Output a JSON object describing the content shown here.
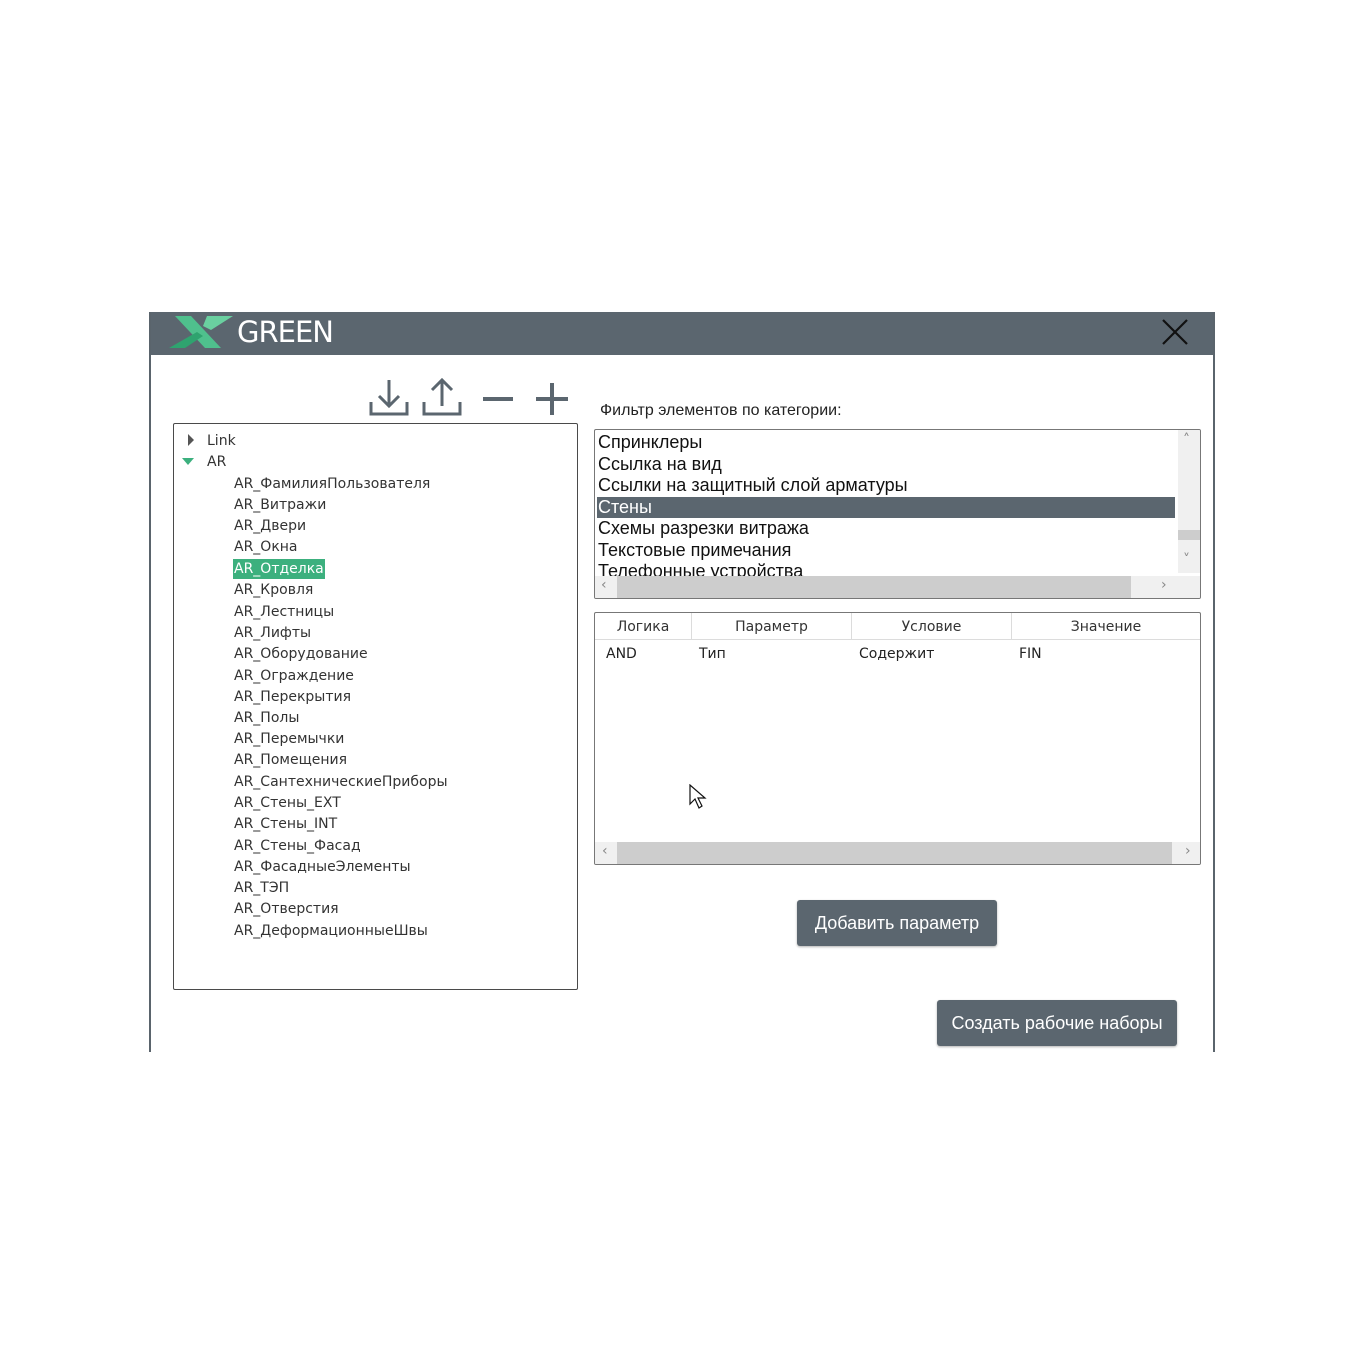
{
  "app": {
    "brand": "GREEN",
    "icons": {
      "logo": "green-x-logo",
      "close": "close-icon",
      "download": "download-icon",
      "upload": "upload-icon",
      "minus": "minus-icon",
      "plus": "plus-icon"
    },
    "colors": {
      "titlebar": "#5b666f",
      "accent_green": "#3cb07e",
      "button": "#5b666f"
    }
  },
  "tree": {
    "roots": [
      {
        "label": "Link",
        "expanded": false
      },
      {
        "label": "AR",
        "expanded": true
      }
    ],
    "children": [
      "AR_ФамилияПользователя",
      "AR_Витражи",
      "AR_Двери",
      "AR_Окна",
      "AR_Отделка",
      "AR_Кровля",
      "AR_Лестницы",
      "AR_Лифты",
      "AR_Оборудование",
      "AR_Ограждение",
      "AR_Перекрытия",
      "AR_Полы",
      "AR_Перемычки",
      "AR_Помещения",
      "AR_СантехническиеПриборы",
      "AR_Стены_EXT",
      "AR_Стены_INT",
      "AR_Стены_Фасад",
      "AR_ФасадныеЭлементы",
      "AR_ТЭП",
      "AR_Отверстия",
      "AR_ДеформационныеШвы"
    ],
    "selected": "AR_Отделка"
  },
  "filter": {
    "label": "Фильтр элементов по категории:",
    "items": [
      "Спринклеры",
      "Ссылка на вид",
      "Ссылки на защитный слой арматуры",
      "Стены",
      "Схемы разрезки витража",
      "Текстовые примечания",
      "Телефонные устройства"
    ],
    "selected": "Стены"
  },
  "conditions": {
    "columns": [
      "Логика",
      "Параметр",
      "Условие",
      "Значение"
    ],
    "rows": [
      [
        "AND",
        "Тип",
        "Содержит",
        "FIN"
      ]
    ]
  },
  "buttons": {
    "add_parameter": "Добавить параметр",
    "create_worksets": "Создать рабочие наборы"
  }
}
